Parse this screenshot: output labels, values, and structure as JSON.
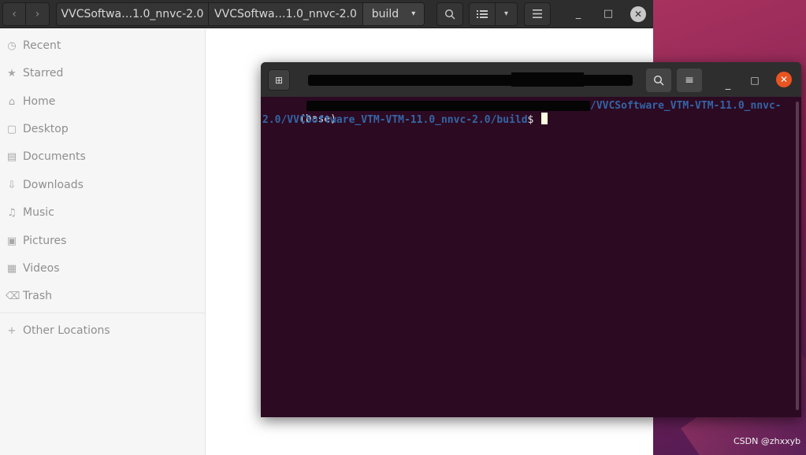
{
  "files_window": {
    "nav": {
      "back_icon": "chevron-left-icon",
      "forward_icon": "chevron-right-icon",
      "back_glyph": "‹",
      "forward_glyph": "›"
    },
    "path_bar": {
      "crumbs": [
        {
          "label": "VVCSoftwa…1.0_nnvc-2.0"
        },
        {
          "label": "VVCSoftwa…1.0_nnvc-2.0"
        },
        {
          "label": "build"
        }
      ],
      "dropdown_glyph": "▾"
    },
    "toolbar": {
      "search_icon": "search-icon",
      "view_list_icon": "list-view-icon",
      "view_dropdown_glyph": "▾",
      "menu_icon": "hamburger-menu-icon"
    },
    "window_controls": {
      "minimize_glyph": "_",
      "maximize_glyph": "□",
      "close_glyph": "✕"
    },
    "sidebar": {
      "items": [
        {
          "label": "Recent",
          "icon": "clock-icon",
          "glyph": "🕓"
        },
        {
          "label": "Starred",
          "icon": "star-icon",
          "glyph": "★"
        },
        {
          "label": "Home",
          "icon": "home-icon",
          "glyph": "⌂"
        },
        {
          "label": "Desktop",
          "icon": "desktop-icon",
          "glyph": "▢"
        },
        {
          "label": "Documents",
          "icon": "document-icon",
          "glyph": "▤"
        },
        {
          "label": "Downloads",
          "icon": "download-icon",
          "glyph": "⇩"
        },
        {
          "label": "Music",
          "icon": "music-icon",
          "glyph": "♫"
        },
        {
          "label": "Pictures",
          "icon": "picture-icon",
          "glyph": "▣"
        },
        {
          "label": "Videos",
          "icon": "video-icon",
          "glyph": "▦"
        },
        {
          "label": "Trash",
          "icon": "trash-icon",
          "glyph": "🗑"
        }
      ],
      "other_locations": {
        "label": "Other Locations",
        "icon": "plus-icon",
        "glyph": "+"
      }
    }
  },
  "terminal": {
    "new_tab_glyph": "⊞",
    "search_glyph": "⌕",
    "menu_glyph": "≡",
    "minimize_glyph": "_",
    "maximize_glyph": "□",
    "close_glyph": "✕",
    "lines": {
      "base": "(base)",
      "path_part1": "/VVCSoftware_VTM-VTM-11.0_nnvc-",
      "path_part2": "2.0/VVCSoftware_VTM-VTM-11.0_nnvc-2.0/build",
      "prompt": "$ "
    }
  },
  "colors": {
    "terminal_bg": "#2c0a22",
    "path_blue": "#3465a4",
    "close_orange": "#e95420",
    "header_dark": "#2d2d2d"
  },
  "watermark": "CSDN @zhxxyb"
}
